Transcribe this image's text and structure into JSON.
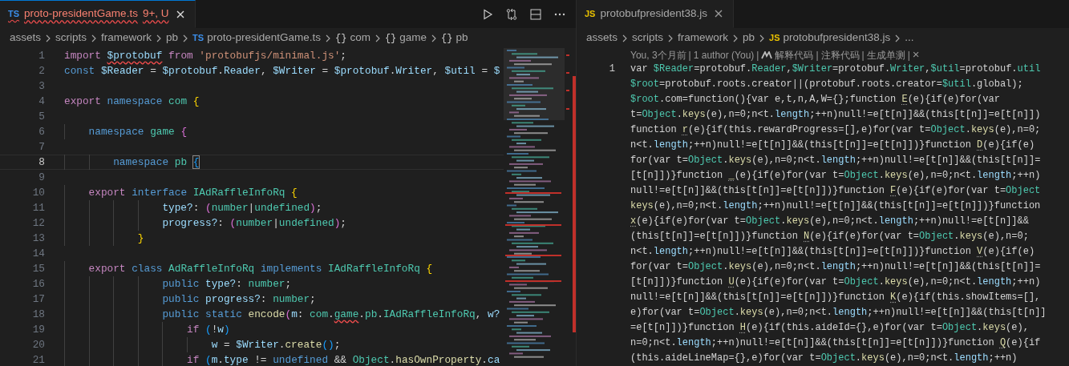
{
  "left_editor": {
    "tabs": [
      {
        "icon": "TS",
        "label": "proto-presidentGame.ts",
        "badge": "9+, U",
        "selected": true
      }
    ],
    "breadcrumbs": [
      {
        "text": "assets"
      },
      {
        "text": "scripts"
      },
      {
        "text": "framework"
      },
      {
        "text": "pb"
      },
      {
        "icon": "TS",
        "text": "proto-presidentGame.ts"
      },
      {
        "icon": "{}",
        "text": "com"
      },
      {
        "icon": "{}",
        "text": "game"
      },
      {
        "icon": "{}",
        "text": "pb"
      }
    ],
    "lines": [
      {
        "number": "1",
        "current": false,
        "tokens": [
          {
            "text": "import ",
            "kind": "control"
          },
          {
            "text": "$protobuf",
            "kind": "var",
            "error": true
          },
          {
            "text": " from ",
            "kind": "control"
          },
          {
            "text": "'protobufjs/minimal.js'",
            "kind": "string"
          },
          {
            "text": ";",
            "kind": "plain"
          }
        ]
      },
      {
        "number": "2",
        "current": false,
        "tokens": [
          {
            "text": "const ",
            "kind": "keyword"
          },
          {
            "text": "$Reader",
            "kind": "var"
          },
          {
            "text": " = ",
            "kind": "plain"
          },
          {
            "text": "$protobuf",
            "kind": "var"
          },
          {
            "text": ".",
            "kind": "plain"
          },
          {
            "text": "Reader",
            "kind": "var"
          },
          {
            "text": ", ",
            "kind": "plain"
          },
          {
            "text": "$Writer",
            "kind": "var"
          },
          {
            "text": " = ",
            "kind": "plain"
          },
          {
            "text": "$protobuf",
            "kind": "var"
          },
          {
            "text": ".",
            "kind": "plain"
          },
          {
            "text": "Writer",
            "kind": "var"
          },
          {
            "text": ", ",
            "kind": "plain"
          },
          {
            "text": "$util",
            "kind": "var"
          },
          {
            "text": " = ",
            "kind": "plain"
          },
          {
            "text": "$",
            "kind": "var"
          }
        ]
      },
      {
        "number": "3",
        "current": false
      },
      {
        "number": "4",
        "current": false,
        "tokens": [
          {
            "text": "export ",
            "kind": "control"
          },
          {
            "text": "namespace ",
            "kind": "keyword"
          },
          {
            "text": "com ",
            "kind": "type"
          },
          {
            "text": "{",
            "kind": "bracket1"
          }
        ]
      },
      {
        "number": "5",
        "current": false
      },
      {
        "number": "6",
        "current": false,
        "tokens": [
          {
            "text": "    namespace ",
            "kind": "keyword"
          },
          {
            "text": "game ",
            "kind": "type"
          },
          {
            "text": "{",
            "kind": "bracket2"
          }
        ]
      },
      {
        "number": "7",
        "current": false
      },
      {
        "number": "8",
        "current": true,
        "tokens": [
          {
            "text": "        namespace ",
            "kind": "keyword"
          },
          {
            "text": "pb ",
            "kind": "type"
          },
          {
            "text": "{",
            "kind": "bracket3",
            "match": true
          }
        ]
      },
      {
        "number": "9",
        "current": false
      },
      {
        "number": "10",
        "current": false,
        "tokens": [
          {
            "text": "    export ",
            "kind": "control"
          },
          {
            "text": "interface ",
            "kind": "keyword"
          },
          {
            "text": "IAdRaffleInfoRq ",
            "kind": "type"
          },
          {
            "text": "{",
            "kind": "bracket1"
          }
        ]
      },
      {
        "number": "11",
        "current": false,
        "tokens": [
          {
            "text": "                type?",
            "kind": "var"
          },
          {
            "text": ": ",
            "kind": "plain"
          },
          {
            "text": "(",
            "kind": "bracket2"
          },
          {
            "text": "number",
            "kind": "type"
          },
          {
            "text": "|",
            "kind": "plain"
          },
          {
            "text": "undefined",
            "kind": "type"
          },
          {
            "text": ")",
            "kind": "bracket2"
          },
          {
            "text": ";",
            "kind": "plain"
          }
        ]
      },
      {
        "number": "12",
        "current": false,
        "tokens": [
          {
            "text": "                progress?",
            "kind": "var"
          },
          {
            "text": ": ",
            "kind": "plain"
          },
          {
            "text": "(",
            "kind": "bracket2"
          },
          {
            "text": "number",
            "kind": "type"
          },
          {
            "text": "|",
            "kind": "plain"
          },
          {
            "text": "undefined",
            "kind": "type"
          },
          {
            "text": ")",
            "kind": "bracket2"
          },
          {
            "text": ";",
            "kind": "plain"
          }
        ]
      },
      {
        "number": "13",
        "current": false,
        "tokens": [
          {
            "text": "            }",
            "kind": "bracket1"
          }
        ]
      },
      {
        "number": "14",
        "current": false
      },
      {
        "number": "15",
        "current": false,
        "tokens": [
          {
            "text": "    export ",
            "kind": "control"
          },
          {
            "text": "class ",
            "kind": "keyword"
          },
          {
            "text": "AdRaffleInfoRq ",
            "kind": "type"
          },
          {
            "text": "implements ",
            "kind": "keyword"
          },
          {
            "text": "IAdRaffleInfoRq ",
            "kind": "type"
          },
          {
            "text": "{",
            "kind": "bracket1"
          }
        ]
      },
      {
        "number": "16",
        "current": false,
        "tokens": [
          {
            "text": "                public ",
            "kind": "keyword"
          },
          {
            "text": "type?",
            "kind": "var"
          },
          {
            "text": ": ",
            "kind": "plain"
          },
          {
            "text": "number",
            "kind": "type"
          },
          {
            "text": ";",
            "kind": "plain"
          }
        ]
      },
      {
        "number": "17",
        "current": false,
        "tokens": [
          {
            "text": "                public ",
            "kind": "keyword"
          },
          {
            "text": "progress?",
            "kind": "var"
          },
          {
            "text": ": ",
            "kind": "plain"
          },
          {
            "text": "number",
            "kind": "type"
          },
          {
            "text": ";",
            "kind": "plain"
          }
        ]
      },
      {
        "number": "18",
        "current": false,
        "tokens": [
          {
            "text": "                public static ",
            "kind": "keyword"
          },
          {
            "text": "encode",
            "kind": "func"
          },
          {
            "text": "(",
            "kind": "bracket2"
          },
          {
            "text": "m",
            "kind": "var"
          },
          {
            "text": ": ",
            "kind": "plain"
          },
          {
            "text": "com",
            "kind": "type"
          },
          {
            "text": ".",
            "kind": "plain"
          },
          {
            "text": "game",
            "kind": "type",
            "error": true
          },
          {
            "text": ".",
            "kind": "plain"
          },
          {
            "text": "pb",
            "kind": "type"
          },
          {
            "text": ".",
            "kind": "plain"
          },
          {
            "text": "IAdRaffleInfoRq",
            "kind": "type"
          },
          {
            "text": ", ",
            "kind": "plain"
          },
          {
            "text": "w?",
            "kind": "var"
          }
        ]
      },
      {
        "number": "19",
        "current": false,
        "tokens": [
          {
            "text": "                    if ",
            "kind": "control"
          },
          {
            "text": "(",
            "kind": "bracket3"
          },
          {
            "text": "!",
            "kind": "plain"
          },
          {
            "text": "w",
            "kind": "var"
          },
          {
            "text": ")",
            "kind": "bracket3"
          }
        ]
      },
      {
        "number": "20",
        "current": false,
        "tokens": [
          {
            "text": "                        w",
            "kind": "var"
          },
          {
            "text": " = ",
            "kind": "plain"
          },
          {
            "text": "$Writer",
            "kind": "var"
          },
          {
            "text": ".",
            "kind": "plain"
          },
          {
            "text": "create",
            "kind": "func"
          },
          {
            "text": "()",
            "kind": "bracket3"
          },
          {
            "text": ";",
            "kind": "plain"
          }
        ]
      },
      {
        "number": "21",
        "current": false,
        "tokens": [
          {
            "text": "                    if ",
            "kind": "control"
          },
          {
            "text": "(",
            "kind": "bracket3"
          },
          {
            "text": "m",
            "kind": "var"
          },
          {
            "text": ".",
            "kind": "plain"
          },
          {
            "text": "type",
            "kind": "var"
          },
          {
            "text": " != ",
            "kind": "plain"
          },
          {
            "text": "undefined",
            "kind": "keyword"
          },
          {
            "text": " && ",
            "kind": "plain"
          },
          {
            "text": "Object",
            "kind": "type"
          },
          {
            "text": ".",
            "kind": "plain"
          },
          {
            "text": "hasOwnProperty",
            "kind": "func"
          },
          {
            "text": ".",
            "kind": "plain"
          },
          {
            "text": "ca",
            "kind": "var"
          }
        ]
      }
    ]
  },
  "right_editor": {
    "tabs": [
      {
        "icon": "JS",
        "label": "protobufpresident38.js",
        "selected": true
      }
    ],
    "breadcrumbs": [
      {
        "text": "assets"
      },
      {
        "text": "scripts"
      },
      {
        "text": "framework"
      },
      {
        "text": "pb"
      },
      {
        "icon": "JS",
        "text": "protobufpresident38.js"
      },
      {
        "text": "..."
      }
    ],
    "codelens": [
      {
        "kind": "link",
        "text": "You, 3个月前"
      },
      {
        "kind": "sep",
        "text": "|"
      },
      {
        "kind": "link",
        "text": "1 author (You)"
      },
      {
        "kind": "sep",
        "text": "|"
      },
      {
        "kind": "logo"
      },
      {
        "kind": "link",
        "text": "解释代码"
      },
      {
        "kind": "sep",
        "text": "|"
      },
      {
        "kind": "link",
        "text": "注释代码"
      },
      {
        "kind": "sep",
        "text": "|"
      },
      {
        "kind": "link",
        "text": "生成单测"
      },
      {
        "kind": "sep",
        "text": "|"
      },
      {
        "kind": "close",
        "text": "×"
      }
    ],
    "lines": [
      {
        "number": "1",
        "rows": [
          {
            "tokens": [
              {
                "text": "var ",
                "kind": "plain"
              },
              {
                "text": "$Reader",
                "kind": "type"
              },
              {
                "text": "=protobuf.",
                "kind": "plain"
              },
              {
                "text": "Reader",
                "kind": "type"
              },
              {
                "text": ",",
                "kind": "plain"
              },
              {
                "text": "$Writer",
                "kind": "type"
              },
              {
                "text": "=protobuf.",
                "kind": "plain"
              },
              {
                "text": "Writer",
                "kind": "type"
              },
              {
                "text": ",",
                "kind": "plain"
              },
              {
                "text": "$util",
                "kind": "type"
              },
              {
                "text": "=protobuf.",
                "kind": "plain"
              },
              {
                "text": "util",
                "kind": "type"
              }
            ]
          },
          {
            "tokens": [
              {
                "text": "$root",
                "kind": "type"
              },
              {
                "text": "=protobuf.roots.creator||(protobuf.roots.creator=",
                "kind": "plain"
              },
              {
                "text": "$util",
                "kind": "type"
              },
              {
                "text": ".global);",
                "kind": "plain"
              }
            ]
          },
          {
            "tokens": [
              {
                "text": "$root",
                "kind": "type"
              },
              {
                "text": ".com=function(){var e,t,n,A,W={};function ",
                "kind": "plain"
              },
              {
                "text": "E",
                "kind": "func",
                "hint": true
              },
              {
                "text": "(e){if(e)for(var",
                "kind": "plain"
              }
            ]
          },
          {
            "tokens": [
              {
                "text": "t=",
                "kind": "plain"
              },
              {
                "text": "Object",
                "kind": "type"
              },
              {
                "text": ".",
                "kind": "plain"
              },
              {
                "text": "keys",
                "kind": "func"
              },
              {
                "text": "(e),n=0;n<t.",
                "kind": "plain"
              },
              {
                "text": "length",
                "kind": "var"
              },
              {
                "text": ";++n)null!=e[t[n]]&&(this[t[n]]=e[t[n]])",
                "kind": "plain"
              }
            ]
          },
          {
            "tokens": [
              {
                "text": "function ",
                "kind": "plain"
              },
              {
                "text": "r",
                "kind": "func",
                "hint": true
              },
              {
                "text": "(e){if(this.rewardProgress=[],e)for(var t=",
                "kind": "plain"
              },
              {
                "text": "Object",
                "kind": "type"
              },
              {
                "text": ".",
                "kind": "plain"
              },
              {
                "text": "keys",
                "kind": "func"
              },
              {
                "text": "(e),n=0;",
                "kind": "plain"
              }
            ]
          },
          {
            "tokens": [
              {
                "text": "n<t.",
                "kind": "plain"
              },
              {
                "text": "length",
                "kind": "var"
              },
              {
                "text": ";++n)null!=e[t[n]]&&(this[t[n]]=e[t[n]])}function ",
                "kind": "plain"
              },
              {
                "text": "D",
                "kind": "func",
                "hint": true
              },
              {
                "text": "(e){if(e)",
                "kind": "plain"
              }
            ]
          },
          {
            "tokens": [
              {
                "text": "for(var t=",
                "kind": "plain"
              },
              {
                "text": "Object",
                "kind": "type"
              },
              {
                "text": ".",
                "kind": "plain"
              },
              {
                "text": "keys",
                "kind": "func"
              },
              {
                "text": "(e),n=0;n<t.",
                "kind": "plain"
              },
              {
                "text": "length",
                "kind": "var"
              },
              {
                "text": ";++n)null!=e[t[n]]&&(this[t[n]]=",
                "kind": "plain"
              }
            ]
          },
          {
            "tokens": [
              {
                "text": "[t[n]])}function ",
                "kind": "plain"
              },
              {
                "text": "_",
                "kind": "func",
                "hint": true
              },
              {
                "text": "(e){if(e)for(var t=",
                "kind": "plain"
              },
              {
                "text": "Object",
                "kind": "type"
              },
              {
                "text": ".",
                "kind": "plain"
              },
              {
                "text": "keys",
                "kind": "func"
              },
              {
                "text": "(e),n=0;n<t.",
                "kind": "plain"
              },
              {
                "text": "length",
                "kind": "var"
              },
              {
                "text": ";++n)",
                "kind": "plain"
              }
            ]
          },
          {
            "tokens": [
              {
                "text": "null!=e[t[n]]&&(this[t[n]]=e[t[n]])}function ",
                "kind": "plain"
              },
              {
                "text": "F",
                "kind": "func",
                "hint": true
              },
              {
                "text": "(e){if(e)for(var t=",
                "kind": "plain"
              },
              {
                "text": "Object",
                "kind": "type"
              }
            ]
          },
          {
            "tokens": [
              {
                "text": "keys",
                "kind": "func"
              },
              {
                "text": "(e),n=0;n<t.",
                "kind": "plain"
              },
              {
                "text": "length",
                "kind": "var"
              },
              {
                "text": ";++n)null!=e[t[n]]&&(this[t[n]]=e[t[n]])}function",
                "kind": "plain"
              }
            ]
          },
          {
            "tokens": [
              {
                "text": "x",
                "kind": "func",
                "hint": true
              },
              {
                "text": "(e){if(e)for(var t=",
                "kind": "plain"
              },
              {
                "text": "Object",
                "kind": "type"
              },
              {
                "text": ".",
                "kind": "plain"
              },
              {
                "text": "keys",
                "kind": "func"
              },
              {
                "text": "(e),n=0;n<t.",
                "kind": "plain"
              },
              {
                "text": "length",
                "kind": "var"
              },
              {
                "text": ";++n)null!=e[t[n]]&&",
                "kind": "plain"
              }
            ]
          },
          {
            "tokens": [
              {
                "text": "(this[t[n]]=e[t[n]])}function ",
                "kind": "plain"
              },
              {
                "text": "N",
                "kind": "func",
                "hint": true
              },
              {
                "text": "(e){if(e)for(var t=",
                "kind": "plain"
              },
              {
                "text": "Object",
                "kind": "type"
              },
              {
                "text": ".",
                "kind": "plain"
              },
              {
                "text": "keys",
                "kind": "func"
              },
              {
                "text": "(e),n=0;",
                "kind": "plain"
              }
            ]
          },
          {
            "tokens": [
              {
                "text": "n<t.",
                "kind": "plain"
              },
              {
                "text": "length",
                "kind": "var"
              },
              {
                "text": ";++n)null!=e[t[n]]&&(this[t[n]]=e[t[n]])}function ",
                "kind": "plain"
              },
              {
                "text": "V",
                "kind": "func",
                "hint": true
              },
              {
                "text": "(e){if(e)",
                "kind": "plain"
              }
            ]
          },
          {
            "tokens": [
              {
                "text": "for(var t=",
                "kind": "plain"
              },
              {
                "text": "Object",
                "kind": "type"
              },
              {
                "text": ".",
                "kind": "plain"
              },
              {
                "text": "keys",
                "kind": "func"
              },
              {
                "text": "(e),n=0;n<t.",
                "kind": "plain"
              },
              {
                "text": "length",
                "kind": "var"
              },
              {
                "text": ";++n)null!=e[t[n]]&&(this[t[n]]=",
                "kind": "plain"
              }
            ]
          },
          {
            "tokens": [
              {
                "text": "[t[n]])}function ",
                "kind": "plain"
              },
              {
                "text": "U",
                "kind": "func",
                "hint": true
              },
              {
                "text": "(e){if(e)for(var t=",
                "kind": "plain"
              },
              {
                "text": "Object",
                "kind": "type"
              },
              {
                "text": ".",
                "kind": "plain"
              },
              {
                "text": "keys",
                "kind": "func"
              },
              {
                "text": "(e),n=0;n<t.",
                "kind": "plain"
              },
              {
                "text": "length",
                "kind": "var"
              },
              {
                "text": ";++n)",
                "kind": "plain"
              }
            ]
          },
          {
            "tokens": [
              {
                "text": "null!=e[t[n]]&&(this[t[n]]=e[t[n]])}function ",
                "kind": "plain"
              },
              {
                "text": "K",
                "kind": "func",
                "hint": true
              },
              {
                "text": "(e){if(this.showItems=[],",
                "kind": "plain"
              }
            ]
          },
          {
            "tokens": [
              {
                "text": "e)for(var t=",
                "kind": "plain"
              },
              {
                "text": "Object",
                "kind": "type"
              },
              {
                "text": ".",
                "kind": "plain"
              },
              {
                "text": "keys",
                "kind": "func"
              },
              {
                "text": "(e),n=0;n<t.",
                "kind": "plain"
              },
              {
                "text": "length",
                "kind": "var"
              },
              {
                "text": ";++n)null!=e[t[n]]&&(this[t[n]]",
                "kind": "plain"
              }
            ]
          },
          {
            "tokens": [
              {
                "text": "=e[t[n]])}function ",
                "kind": "plain"
              },
              {
                "text": "H",
                "kind": "func",
                "hint": true
              },
              {
                "text": "(e){if(this.aideId={},e)for(var t=",
                "kind": "plain"
              },
              {
                "text": "Object",
                "kind": "type"
              },
              {
                "text": ".",
                "kind": "plain"
              },
              {
                "text": "keys",
                "kind": "func"
              },
              {
                "text": "(e),",
                "kind": "plain"
              }
            ]
          },
          {
            "tokens": [
              {
                "text": "n=0;n<t.",
                "kind": "plain"
              },
              {
                "text": "length",
                "kind": "var"
              },
              {
                "text": ";++n)null!=e[t[n]]&&(this[t[n]]=e[t[n]])}function ",
                "kind": "plain"
              },
              {
                "text": "Q",
                "kind": "func",
                "hint": true
              },
              {
                "text": "(e){if",
                "kind": "plain"
              }
            ]
          },
          {
            "tokens": [
              {
                "text": "(this.aideLineMap={},e)for(var t=",
                "kind": "plain"
              },
              {
                "text": "Object",
                "kind": "type"
              },
              {
                "text": ".",
                "kind": "plain"
              },
              {
                "text": "keys",
                "kind": "func"
              },
              {
                "text": "(e),n=0;n<t.",
                "kind": "plain"
              },
              {
                "text": "length",
                "kind": "var"
              },
              {
                "text": ";++n)",
                "kind": "plain"
              }
            ]
          }
        ]
      }
    ]
  }
}
